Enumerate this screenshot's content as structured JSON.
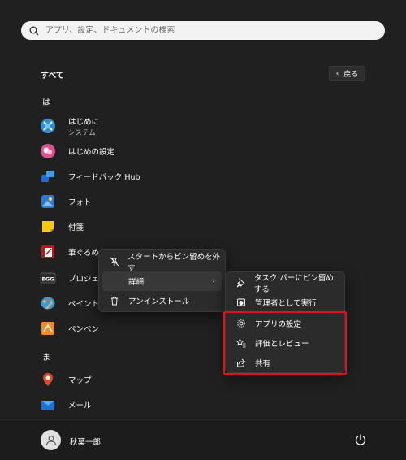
{
  "search": {
    "placeholder": "アプリ、設定、ドキュメントの検索"
  },
  "all_label": "すべて",
  "back_label": "戻る",
  "sections": [
    {
      "letter": "は"
    },
    {
      "letter": "ま"
    }
  ],
  "apps": [
    {
      "name": "はじめに",
      "sub": "システム",
      "icon": "get-started-icon"
    },
    {
      "name": "はじめの設定",
      "icon": "initial-setup-icon"
    },
    {
      "name": "フィードバック Hub",
      "icon": "feedback-hub-icon"
    },
    {
      "name": "フォト",
      "icon": "photos-icon"
    },
    {
      "name": "付箋",
      "icon": "sticky-notes-icon"
    },
    {
      "name": "筆ぐるめ 3",
      "icon": "fudegurume-icon"
    },
    {
      "name": "プロジェクト",
      "icon": "egg-project-icon"
    },
    {
      "name": "ペイント",
      "icon": "paint-icon"
    },
    {
      "name": "ペンペン",
      "icon": "penpen-icon"
    },
    {
      "name": "マップ",
      "icon": "maps-icon"
    },
    {
      "name": "メール",
      "icon": "mail-icon"
    }
  ],
  "context_menu": {
    "items": [
      {
        "label": "スタートからピン留めを外す",
        "icon": "unpin-icon"
      },
      {
        "label": "詳細",
        "icon": "",
        "arrow": "›"
      },
      {
        "label": "アンインストール",
        "icon": "trash-icon"
      }
    ]
  },
  "submenu": {
    "items": [
      {
        "label": "タスク バーにピン留めする",
        "icon": "pin-icon"
      },
      {
        "label": "管理者として実行",
        "icon": "admin-shield-icon"
      },
      {
        "label": "アプリの設定",
        "icon": "gear-icon"
      },
      {
        "label": "評価とレビュー",
        "icon": "star-list-icon"
      },
      {
        "label": "共有",
        "icon": "share-icon"
      }
    ]
  },
  "footer": {
    "user_name": "秋葉一郎"
  },
  "colors": {
    "background": "#202020",
    "menu_bg": "#2b2b2b",
    "highlight": "#e0121d"
  }
}
